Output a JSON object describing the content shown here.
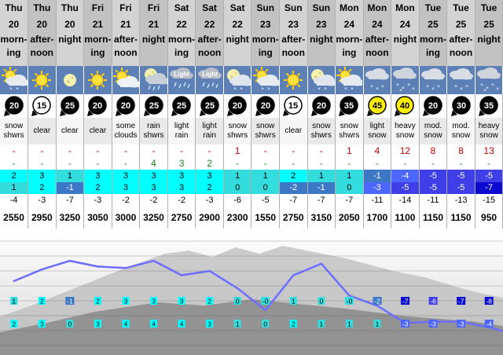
{
  "colors": {
    "header_bg": "#d3d3d3",
    "header_alt_bg": "#c2c2c2",
    "icon_row_bg": "#5d80b7",
    "snow_text": "#c00000",
    "rain_text": "#1a8c1a",
    "fl_line": "#6d6dff",
    "temp_scale": [
      {
        "max": 99,
        "min": 2,
        "bg": "#00ffff"
      },
      {
        "max": 1,
        "min": 0,
        "bg": "#33dddd"
      },
      {
        "max": -1,
        "min": -2,
        "bg": "#3c78c6"
      },
      {
        "max": -3,
        "min": -4,
        "bg": "#4c66ff"
      },
      {
        "max": -5,
        "min": -6,
        "bg": "#3f3fe8"
      },
      {
        "max": -7,
        "min": -99,
        "bg": "#0a0ad0"
      }
    ]
  },
  "columns": [
    {
      "day": "Thu",
      "date": "20",
      "time": "morn- ing",
      "icon": "sun-cloud-snow-icon",
      "wind": 20,
      "wind_style": "dark",
      "summary": "snow shwrs",
      "snow": "-",
      "rain": "-",
      "tmax": "2",
      "tmin": "1",
      "chill": "-4",
      "fl": "2550",
      "alt": false
    },
    {
      "day": "Thu",
      "date": "20",
      "time": "after- noon",
      "icon": "sun-icon",
      "wind": 15,
      "wind_style": "light",
      "summary": "clear",
      "snow": "-",
      "rain": "-",
      "tmax": "3",
      "tmin": "2",
      "chill": "-3",
      "fl": "2950",
      "alt": true
    },
    {
      "day": "Thu",
      "date": "20",
      "time": "night",
      "icon": "moon-icon",
      "wind": 25,
      "wind_style": "dark",
      "summary": "clear",
      "snow": "-",
      "rain": "-",
      "tmax": "1",
      "tmin": "-1",
      "chill": "-7",
      "fl": "3250",
      "alt": false
    },
    {
      "day": "Fri",
      "date": "21",
      "time": "morn- ing",
      "icon": "sun-icon",
      "wind": 20,
      "wind_style": "dark",
      "summary": "clear",
      "snow": "-",
      "rain": "-",
      "tmax": "3",
      "tmin": "2",
      "chill": "-3",
      "fl": "3050",
      "alt": true
    },
    {
      "day": "Fri",
      "date": "21",
      "time": "after- noon",
      "icon": "sun-cloud-icon",
      "wind": 20,
      "wind_style": "dark",
      "summary": "some clouds",
      "snow": "-",
      "rain": "-",
      "tmax": "3",
      "tmin": "3",
      "chill": "-2",
      "fl": "3000",
      "alt": false
    },
    {
      "day": "Fri",
      "date": "21",
      "time": "night",
      "icon": "moon-rain-icon",
      "wind": 25,
      "wind_style": "dark",
      "summary": "rain shwrs",
      "snow": "-",
      "rain": "4",
      "tmax": "3",
      "tmin": "3",
      "chill": "-2",
      "fl": "3250",
      "alt": true
    },
    {
      "day": "Sat",
      "date": "22",
      "time": "morn- ing",
      "icon": "cloud-rain-icon",
      "icon_label": "Light",
      "wind": 25,
      "wind_style": "dark",
      "summary": "light rain",
      "snow": "-",
      "rain": "3",
      "tmax": "3",
      "tmin": "3",
      "chill": "-2",
      "fl": "2750",
      "alt": false
    },
    {
      "day": "Sat",
      "date": "22",
      "time": "after- noon",
      "icon": "cloud-rain-icon",
      "icon_label": "Light",
      "wind": 25,
      "wind_style": "dark",
      "summary": "light rain",
      "snow": "-",
      "rain": "2",
      "tmax": "3",
      "tmin": "2",
      "chill": "-3",
      "fl": "2900",
      "alt": true
    },
    {
      "day": "Sat",
      "date": "22",
      "time": "night",
      "icon": "moon-snow-icon",
      "wind": 20,
      "wind_style": "dark",
      "summary": "snow shwrs",
      "snow": "1",
      "rain": "-",
      "tmax": "1",
      "tmin": "0",
      "chill": "-6",
      "fl": "2300",
      "alt": false
    },
    {
      "day": "Sun",
      "date": "23",
      "time": "morn- ing",
      "icon": "sun-cloud-snow-icon",
      "wind": 20,
      "wind_style": "dark",
      "summary": "snow shwrs",
      "snow": "-",
      "rain": "-",
      "tmax": "1",
      "tmin": "0",
      "chill": "-5",
      "fl": "1550",
      "alt": true
    },
    {
      "day": "Sun",
      "date": "23",
      "time": "after- noon",
      "icon": "sun-icon",
      "wind": 15,
      "wind_style": "light",
      "summary": "clear",
      "snow": "-",
      "rain": "-",
      "tmax": "2",
      "tmin": "-2",
      "chill": "-7",
      "fl": "2750",
      "alt": false
    },
    {
      "day": "Sun",
      "date": "23",
      "time": "night",
      "icon": "moon-snow-icon",
      "wind": 20,
      "wind_style": "dark",
      "summary": "snow shwrs",
      "snow": "-",
      "rain": "-",
      "tmax": "1",
      "tmin": "-1",
      "chill": "-7",
      "fl": "3150",
      "alt": true
    },
    {
      "day": "Mon",
      "date": "24",
      "time": "morn- ing",
      "icon": "sun-cloud-snow-icon",
      "wind": 35,
      "wind_style": "dark",
      "summary": "snow shwrs",
      "snow": "1",
      "rain": "-",
      "tmax": "1",
      "tmin": "0",
      "chill": "-7",
      "fl": "2050",
      "alt": false
    },
    {
      "day": "Mon",
      "date": "24",
      "time": "after- noon",
      "icon": "cloud-snow-icon",
      "wind": 45,
      "wind_style": "yellow",
      "summary": "light snow",
      "snow": "4",
      "rain": "-",
      "tmax": "-1",
      "tmin": "-3",
      "chill": "-11",
      "fl": "1700",
      "alt": true
    },
    {
      "day": "Mon",
      "date": "24",
      "time": "night",
      "icon": "cloud-heavy-snow-icon",
      "wind": 40,
      "wind_style": "yellow",
      "summary": "heavy snow",
      "snow": "12",
      "rain": "-",
      "tmax": "-4",
      "tmin": "-5",
      "chill": "-14",
      "fl": "1100",
      "alt": false
    },
    {
      "day": "Tue",
      "date": "25",
      "time": "morn- ing",
      "icon": "cloud-snow-icon",
      "wind": 20,
      "wind_style": "dark",
      "summary": "mod. snow",
      "snow": "8",
      "rain": "-",
      "tmax": "-5",
      "tmin": "-5",
      "chill": "-11",
      "fl": "1150",
      "alt": true
    },
    {
      "day": "Tue",
      "date": "25",
      "time": "after- noon",
      "icon": "cloud-snow-icon",
      "wind": 30,
      "wind_style": "dark",
      "summary": "mod. snow",
      "snow": "8",
      "rain": "-",
      "tmax": "-5",
      "tmin": "-5",
      "chill": "-13",
      "fl": "1150",
      "alt": false
    },
    {
      "day": "Tue",
      "date": "25",
      "time": "night",
      "icon": "cloud-heavy-snow-icon",
      "wind": 35,
      "wind_style": "dark",
      "summary": "heavy snow",
      "snow": "13",
      "rain": "-",
      "tmax": "-5",
      "tmin": "-7",
      "chill": "-15",
      "fl": "950",
      "alt": true
    }
  ],
  "chart_data": {
    "type": "line",
    "x": [
      "Thu 20 morning",
      "Thu 20 afternoon",
      "Thu 20 night",
      "Fri 21 morning",
      "Fri 21 afternoon",
      "Fri 21 night",
      "Sat 22 morning",
      "Sat 22 afternoon",
      "Sat 22 night",
      "Sun 23 morning",
      "Sun 23 afternoon",
      "Sun 23 night",
      "Mon 24 morning",
      "Mon 24 afternoon",
      "Mon 24 night",
      "Tue 25 morning",
      "Tue 25 afternoon",
      "Tue 25 night"
    ],
    "series": [
      {
        "values": [
          2550,
          2950,
          3250,
          3050,
          3000,
          3250,
          2750,
          2900,
          2300,
          1550,
          2750,
          3150,
          2050,
          1700,
          1100,
          1150,
          1150,
          950
        ]
      }
    ],
    "ylim": [
      0,
      4200
    ],
    "labels_upper": [
      "1",
      "2",
      "-1",
      "2",
      "3",
      "3",
      "3",
      "2",
      "0",
      "-0",
      "1",
      "0",
      "-0",
      "-2",
      "-7",
      "-6",
      "-7",
      "-8"
    ],
    "labels_lower": [
      "2",
      "3",
      "0",
      "3",
      "4",
      "4",
      "4",
      "3",
      "1",
      "0",
      "2",
      "1",
      "1",
      "1",
      "-3",
      "-3",
      "-3",
      "-4"
    ]
  }
}
